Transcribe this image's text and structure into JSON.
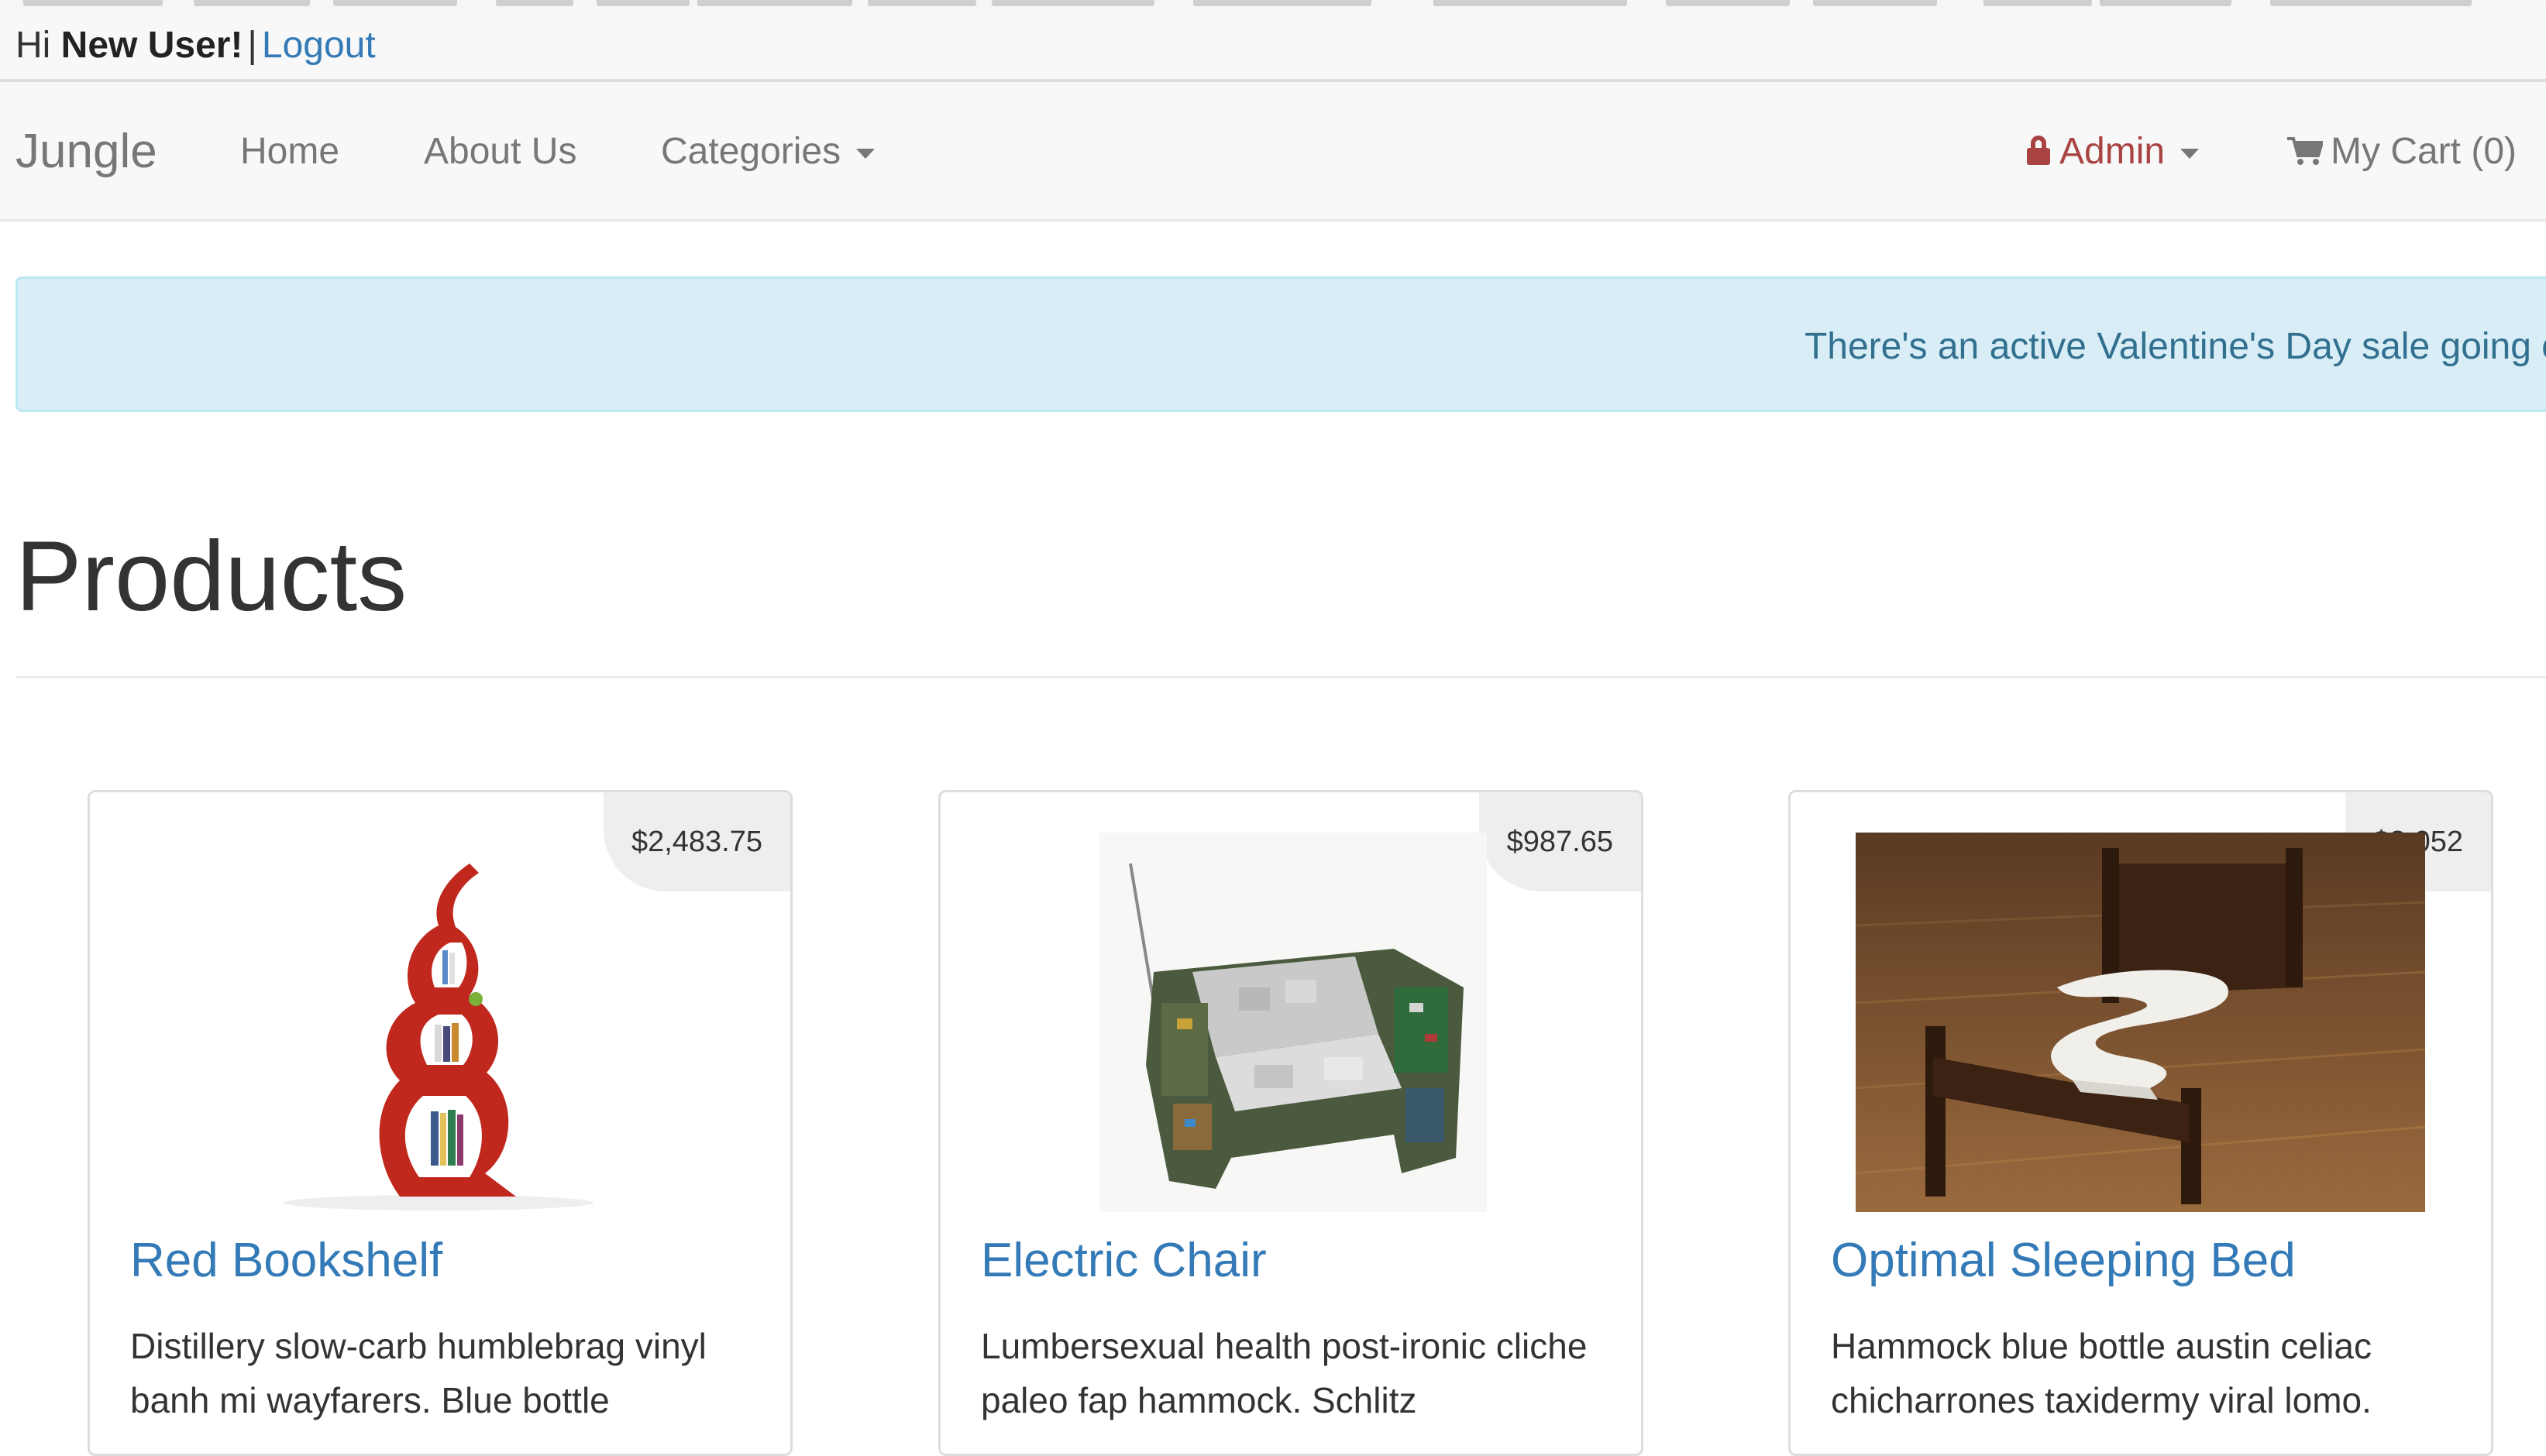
{
  "header": {
    "greeting_prefix": "Hi",
    "username": "New User!",
    "separator": "|",
    "logout_label": "Logout"
  },
  "navbar": {
    "brand": "Jungle",
    "links": {
      "home": "Home",
      "about": "About Us",
      "categories": "Categories"
    },
    "admin_label": "Admin",
    "cart_label": "My Cart (0)"
  },
  "alert": {
    "text": "There's an active Valentine's Day sale going on!"
  },
  "page": {
    "title": "Products"
  },
  "products": [
    {
      "name": "Red Bookshelf",
      "price": "$2,483.75",
      "description": "Distillery slow-carb humblebrag vinyl banh mi wayfarers. Blue bottle"
    },
    {
      "name": "Electric Chair",
      "price": "$987.65",
      "description": "Lumbersexual health post-ironic cliche paleo fap hammock. Schlitz"
    },
    {
      "name": "Optimal Sleeping Bed",
      "price": "$3,052",
      "description": "Hammock blue bottle austin celiac chicharrones taxidermy viral lomo."
    }
  ],
  "colors": {
    "link": "#337ab7",
    "admin": "#a94442",
    "alert_bg": "#d9edf7",
    "alert_text": "#31708f",
    "navbar_bg": "#f8f8f8"
  },
  "icons": {
    "admin": "lock-icon",
    "cart": "cart-icon",
    "dropdown": "caret-down-icon"
  }
}
